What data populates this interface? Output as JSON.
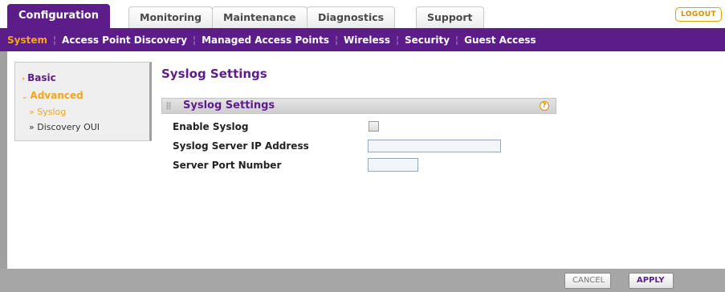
{
  "tabs": [
    {
      "label": "Configuration",
      "active": true
    },
    {
      "label": "Monitoring",
      "active": false
    },
    {
      "label": "Maintenance",
      "active": false
    },
    {
      "label": "Diagnostics",
      "active": false
    },
    {
      "label": "Support",
      "active": false
    }
  ],
  "logout_label": "LOGOUT",
  "subnav": [
    {
      "label": "System",
      "active": true
    },
    {
      "label": "Access Point Discovery",
      "active": false
    },
    {
      "label": "Managed Access Points",
      "active": false
    },
    {
      "label": "Wireless",
      "active": false
    },
    {
      "label": "Security",
      "active": false
    },
    {
      "label": "Guest Access",
      "active": false
    }
  ],
  "sidemenu": {
    "basic": "Basic",
    "advanced": "Advanced",
    "syslog": "» Syslog",
    "discovery_oui": "» Discovery OUI"
  },
  "page_title": "Syslog Settings",
  "panel": {
    "title": "Syslog Settings",
    "help_icon": "?",
    "fields": {
      "enable_label": "Enable Syslog",
      "enable_checked": false,
      "ip_label": "Syslog Server IP Address",
      "ip_value": "",
      "port_label": "Server Port Number",
      "port_value": ""
    }
  },
  "buttons": {
    "cancel": "CANCEL",
    "apply": "APPLY"
  },
  "colors": {
    "brand_purple": "#5c1d8a",
    "accent_orange": "#f3a51e"
  }
}
